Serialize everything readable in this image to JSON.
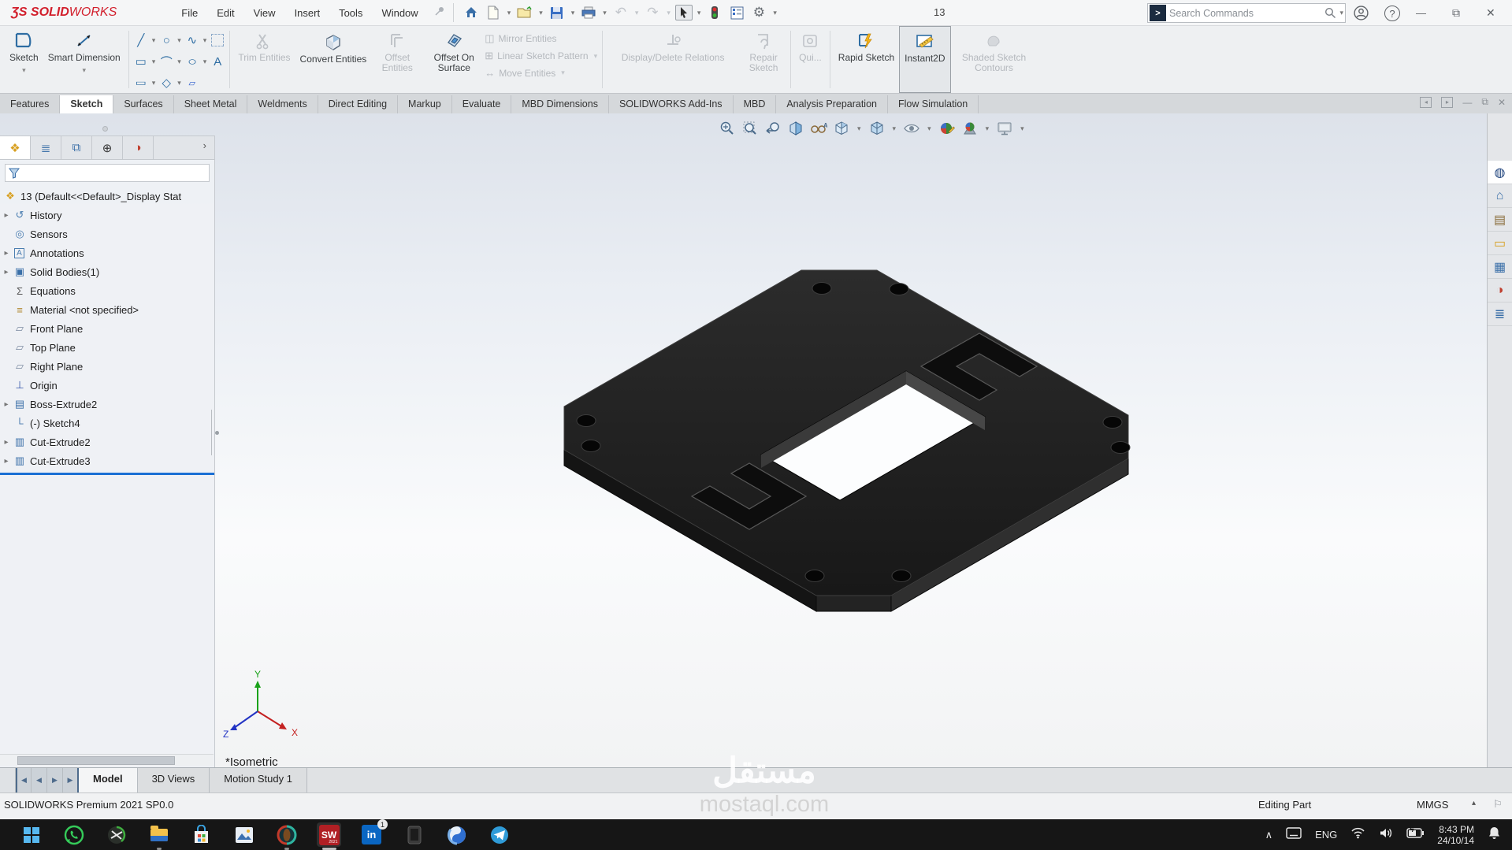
{
  "titlebar": {
    "logo_glyph": "ƷS",
    "logo_solid": "SOLID",
    "logo_works": "WORKS",
    "menus": [
      "File",
      "Edit",
      "View",
      "Insert",
      "Tools",
      "Window"
    ],
    "document_title": "13",
    "search_placeholder": "Search Commands"
  },
  "ribbon": {
    "sketch": {
      "label": "Sketch"
    },
    "smart_dimension": {
      "label": "Smart Dimension"
    },
    "trim_entities": {
      "label": "Trim Entities"
    },
    "convert_entities": {
      "label": "Convert Entities"
    },
    "offset_entities": {
      "label": "Offset Entities"
    },
    "offset_on_surface": {
      "label": "Offset On Surface"
    },
    "mirror_entities": {
      "label": "Mirror Entities"
    },
    "linear_sketch_pattern": {
      "label": "Linear Sketch Pattern"
    },
    "move_entities": {
      "label": "Move Entities"
    },
    "display_delete_relations": {
      "label": "Display/Delete Relations"
    },
    "repair_sketch": {
      "label": "Repair Sketch"
    },
    "quick_snaps": {
      "label": "Qui..."
    },
    "rapid_sketch": {
      "label": "Rapid Sketch"
    },
    "instant2d": {
      "label": "Instant2D"
    },
    "shaded_sketch_contours": {
      "label": "Shaded Sketch Contours"
    }
  },
  "command_tabs": {
    "active": "Sketch",
    "items": [
      "Features",
      "Sketch",
      "Surfaces",
      "Sheet Metal",
      "Weldments",
      "Direct Editing",
      "Markup",
      "Evaluate",
      "MBD Dimensions",
      "SOLIDWORKS Add-Ins",
      "MBD",
      "Analysis Preparation",
      "Flow Simulation"
    ]
  },
  "feature_manager": {
    "root_label": "13 (Default<<Default>_Display Stat",
    "items": [
      {
        "label": "History",
        "glyph": "↺",
        "expandable": true
      },
      {
        "label": "Sensors",
        "glyph": "◎",
        "expandable": false
      },
      {
        "label": "Annotations",
        "glyph": "A",
        "expandable": true
      },
      {
        "label": "Solid Bodies(1)",
        "glyph": "▣",
        "expandable": true
      },
      {
        "label": "Equations",
        "glyph": "Σ",
        "expandable": false
      },
      {
        "label": "Material <not specified>",
        "glyph": "≡",
        "expandable": false
      },
      {
        "label": "Front Plane",
        "glyph": "▱",
        "expandable": false
      },
      {
        "label": "Top Plane",
        "glyph": "▱",
        "expandable": false
      },
      {
        "label": "Right Plane",
        "glyph": "▱",
        "expandable": false
      },
      {
        "label": "Origin",
        "glyph": "⊥",
        "expandable": false
      },
      {
        "label": "Boss-Extrude2",
        "glyph": "▤",
        "expandable": true
      },
      {
        "label": "(-) Sketch4",
        "glyph": "└",
        "expandable": false
      },
      {
        "label": "Cut-Extrude2",
        "glyph": "▥",
        "expandable": true
      },
      {
        "label": "Cut-Extrude3",
        "glyph": "▥",
        "expandable": true
      }
    ]
  },
  "viewport": {
    "view_label": "*Isometric",
    "triad": {
      "x": "X",
      "y": "Y",
      "z": "Z"
    }
  },
  "model_tabs": {
    "active": "Model",
    "items": [
      "Model",
      "3D Views",
      "Motion Study 1"
    ]
  },
  "statusbar": {
    "left": "SOLIDWORKS Premium 2021 SP0.0",
    "mode": "Editing Part",
    "units": "MMGS"
  },
  "taskbar": {
    "solidworks_label": "SW",
    "solidworks_year": "2021",
    "linkedin_label": "in",
    "linkedin_badge": "1",
    "tray": {
      "language": "ENG",
      "time": "8:43 PM",
      "date": "24/10/14"
    }
  },
  "watermark": {
    "arabic": "مستقل",
    "latin": "mostaql.com"
  },
  "icons": {
    "dropdown": "▾",
    "expand_arrow": "▸",
    "fm_chevron": "›",
    "undo": "↶",
    "redo": "↷",
    "gear": "⚙",
    "home": "⌂",
    "minimize": "—",
    "restore": "⧉",
    "close": "✕",
    "help": "?",
    "line": "╱",
    "circle": "○",
    "spline": "∿",
    "rectangle": "▭",
    "arc": "⌒",
    "ellipse": "○",
    "text": "A",
    "slot": "▭",
    "polygon": "◇",
    "point_rect": "▱",
    "mirror": "◫",
    "pattern": "⊞",
    "move": "↔",
    "trim": "✂",
    "fm_part": "❖",
    "fm_props": "≣",
    "fm_config": "⧉",
    "fm_dimx": "⊕",
    "fm_display": "◑",
    "tp_web": "◍",
    "tp_home": "⌂",
    "tp_library": "▤",
    "tp_folder": "▭",
    "tp_palette": "▦",
    "tp_appearance": "◑",
    "tp_props": "≣",
    "nav_first": "◀",
    "nav_prev": "◀",
    "nav_next": "▶",
    "nav_last": "▶",
    "units_caret": "▴",
    "tag": "⚐",
    "tray_chevron": "∧",
    "pane_left": "◂",
    "pane_right": "▸",
    "battery_bolt": "ϟ"
  },
  "colors": {
    "logo_red": "#d21f2c",
    "accent_blue": "#2e6da3",
    "rollback_blue": "#1a6fd4",
    "part_dark": "#1f1f1f",
    "taskbar_black": "#161616"
  }
}
